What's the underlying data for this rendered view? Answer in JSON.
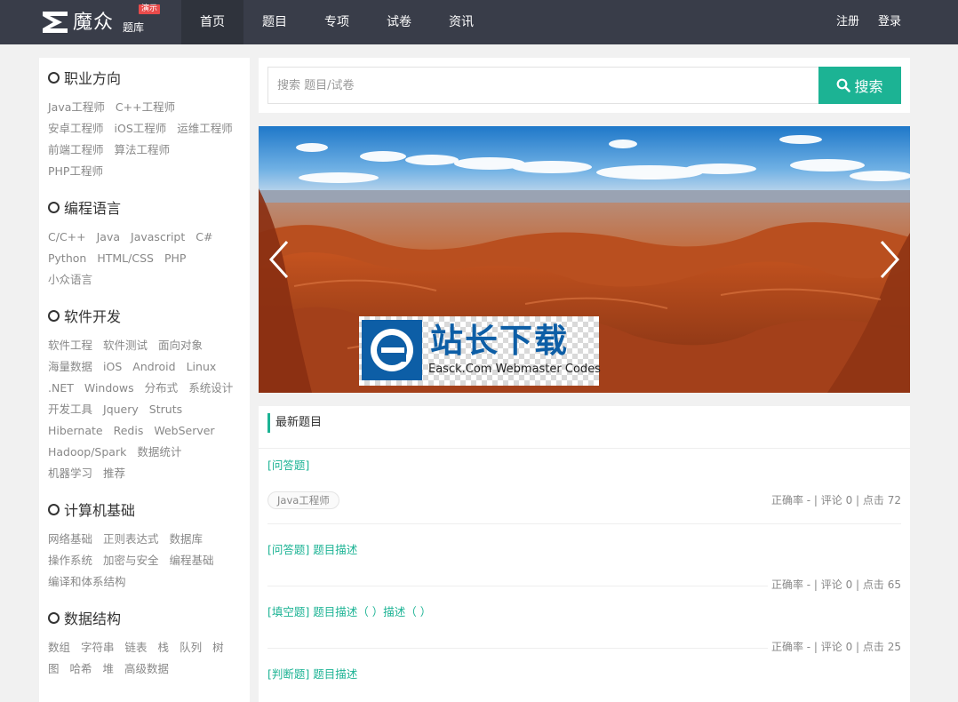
{
  "brand": {
    "name": "魔众",
    "sub": "题库",
    "badge": "演示"
  },
  "nav": {
    "items": [
      "首页",
      "题目",
      "专项",
      "试卷",
      "资讯"
    ],
    "active": 0,
    "register": "注册",
    "login": "登录"
  },
  "sidebar": {
    "categories": [
      {
        "title": "职业方向",
        "tags": [
          "Java工程师",
          "C++工程师",
          "安卓工程师",
          "iOS工程师",
          "运维工程师",
          "前端工程师",
          "算法工程师",
          "PHP工程师"
        ]
      },
      {
        "title": "编程语言",
        "tags": [
          "C/C++",
          "Java",
          "Javascript",
          "C#",
          "Python",
          "HTML/CSS",
          "PHP",
          "小众语言"
        ]
      },
      {
        "title": "软件开发",
        "tags": [
          "软件工程",
          "软件测试",
          "面向对象",
          "海量数据",
          "iOS",
          "Android",
          "Linux",
          ".NET",
          "Windows",
          "分布式",
          "系统设计",
          "开发工具",
          "Jquery",
          "Struts",
          "Hibernate",
          "Redis",
          "WebServer",
          "Hadoop/Spark",
          "数据统计",
          "机器学习",
          "推荐"
        ]
      },
      {
        "title": "计算机基础",
        "tags": [
          "网络基础",
          "正则表达式",
          "数据库",
          "操作系统",
          "加密与安全",
          "编程基础",
          "编译和体系结构"
        ]
      },
      {
        "title": "数据结构",
        "tags": [
          "数组",
          "字符串",
          "链表",
          "栈",
          "队列",
          "树",
          "图",
          "哈希",
          "堆",
          "高级数据"
        ]
      }
    ]
  },
  "search": {
    "placeholder": "搜索 题目/试卷",
    "button": "搜索"
  },
  "banner": {
    "watermark_cn": "站长下载",
    "watermark_en": "Easck.Com Webmaster Codes"
  },
  "latest": {
    "title": "最新题目",
    "questions": [
      {
        "type": "[问答题]",
        "title": "",
        "tag": "Java工程师",
        "meta": "正确率 - | 评论 0 | 点击 72"
      },
      {
        "type": "[问答题]",
        "title": "题目描述",
        "meta": "正确率 - | 评论 0 | 点击 65"
      },
      {
        "type": "[填空题]",
        "title": "题目描述（ ）描述（ ）",
        "meta": "正确率 - | 评论 0 | 点击 25"
      },
      {
        "type": "[判断题]",
        "title": "题目描述",
        "meta": ""
      }
    ]
  },
  "colors": {
    "nav_bg": "#393d49",
    "accent": "#1cb394",
    "badge": "#e94b4b"
  }
}
